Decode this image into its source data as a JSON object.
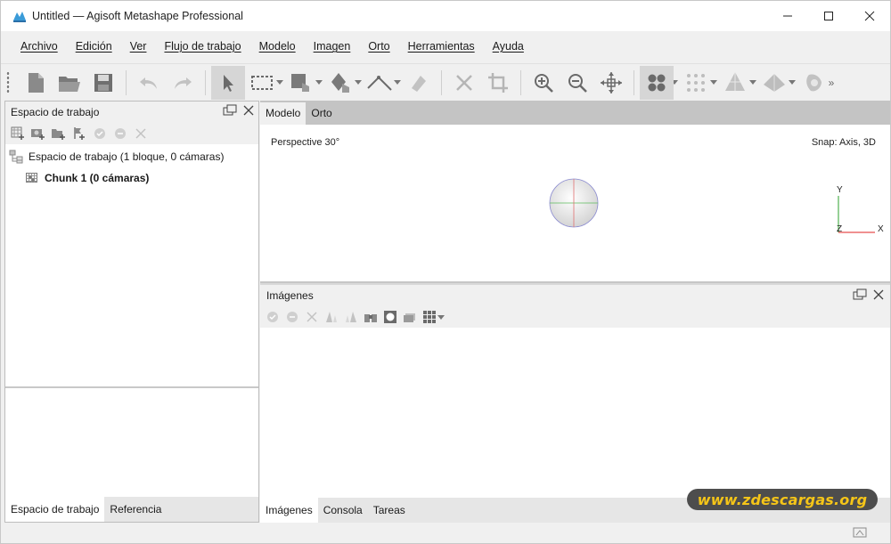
{
  "window": {
    "title": "Untitled — Agisoft Metashape Professional"
  },
  "menu": [
    "Archivo",
    "Edición",
    "Ver",
    "Flujo de trabajo",
    "Modelo",
    "Imagen",
    "Orto",
    "Herramientas",
    "Ayuda"
  ],
  "workspace_panel": {
    "title": "Espacio de trabajo",
    "root_label": "Espacio de trabajo (1 bloque, 0 cámaras)",
    "chunk_label": "Chunk 1 (0 cámaras)",
    "tabs": [
      "Espacio de trabajo",
      "Referencia"
    ],
    "active_tab": "Espacio de trabajo"
  },
  "view_tabs": [
    "Modelo",
    "Orto"
  ],
  "model_view": {
    "projection": "Perspective 30°",
    "snap": "Snap: Axis, 3D",
    "axis_y": "Y",
    "axis_z": "Z",
    "axis_x": "X"
  },
  "images_panel": {
    "title": "Imágenes",
    "tabs": [
      "Imágenes",
      "Consola",
      "Tareas"
    ]
  },
  "watermark": "www.zdescargas.org",
  "colors": {
    "window_bg": "#f0f0f0",
    "accent_active": "#d6d6d6",
    "axis_x": "#e02020",
    "axis_y": "#2ca02c",
    "watermark_text": "#f5c518"
  }
}
